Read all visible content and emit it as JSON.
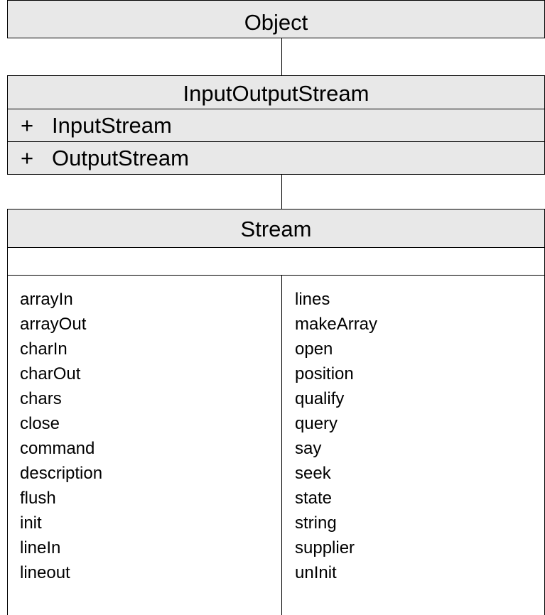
{
  "object_class": {
    "name": "Object"
  },
  "io_class": {
    "name": "InputOutputStream",
    "rows": [
      {
        "symbol": "+",
        "label": "InputStream"
      },
      {
        "symbol": "+",
        "label": "OutputStream"
      }
    ]
  },
  "stream_class": {
    "name": "Stream",
    "methods_left": [
      "arrayIn",
      "arrayOut",
      "charIn",
      "charOut",
      "chars",
      "close",
      "command",
      "description",
      "flush",
      "init",
      "lineIn",
      "lineout"
    ],
    "methods_right": [
      "lines",
      "makeArray",
      "open",
      "position",
      "qualify",
      "query",
      "say",
      "seek",
      "state",
      "string",
      "supplier",
      "unInit"
    ]
  }
}
